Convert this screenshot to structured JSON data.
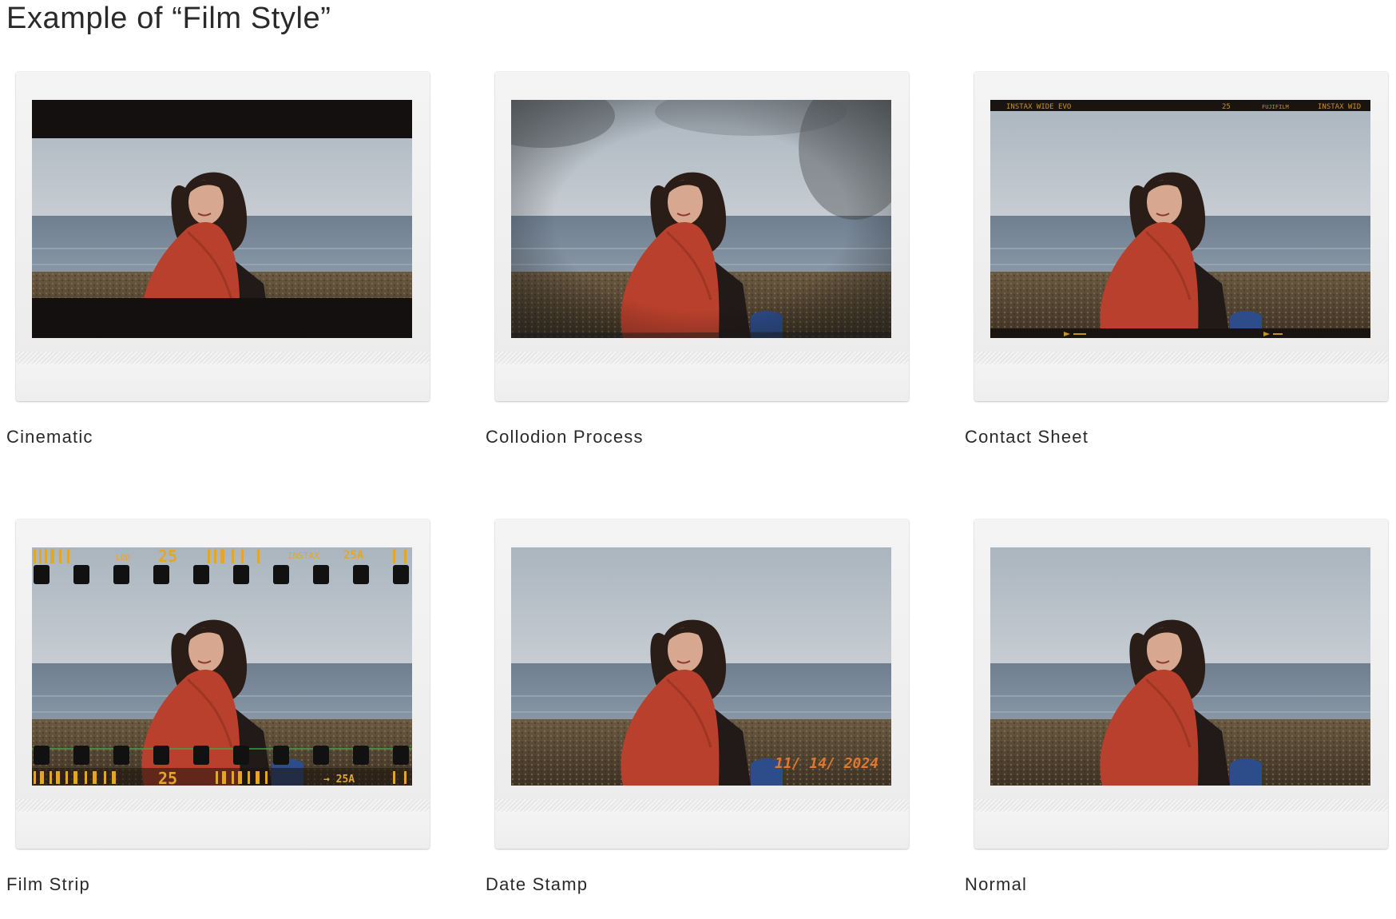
{
  "page": {
    "title": "Example of “Film Style”"
  },
  "styles": [
    {
      "key": "cinematic",
      "label": "Cinematic",
      "effect": "letterbox"
    },
    {
      "key": "collodion",
      "label": "Collodion Process",
      "effect": "collodion"
    },
    {
      "key": "contact",
      "label": "Contact Sheet",
      "effect": "contact-sheet"
    },
    {
      "key": "filmstrip",
      "label": "Film Strip",
      "effect": "film-strip"
    },
    {
      "key": "datestamp",
      "label": "Date Stamp",
      "effect": "date-stamp"
    },
    {
      "key": "normal",
      "label": "Normal",
      "effect": "none"
    }
  ],
  "overlays": {
    "contact_sheet": {
      "left_text": "INSTAX WIDE EVO",
      "middle_text": "25",
      "brand_text": "FUJIFILM",
      "right_text": "INSTAX WID"
    },
    "film_strip": {
      "top_left": "LOD",
      "top_number": "25",
      "top_brand": "INSTAX",
      "top_code": "25A",
      "bottom_number": "25",
      "bottom_code": "→ 25A"
    },
    "date_stamp": {
      "text": "11/ 14/ 2024"
    }
  },
  "colors": {
    "sky": "#bcc4cc",
    "sea": "#7a8a9a",
    "beach": "#5b4d38",
    "jacket": "#b8402c",
    "hair": "#2a1c16",
    "skin": "#d7a88f",
    "frame": "#f0f0f0",
    "film_orange": "#e2a72a",
    "date_orange": "#e0792f"
  }
}
